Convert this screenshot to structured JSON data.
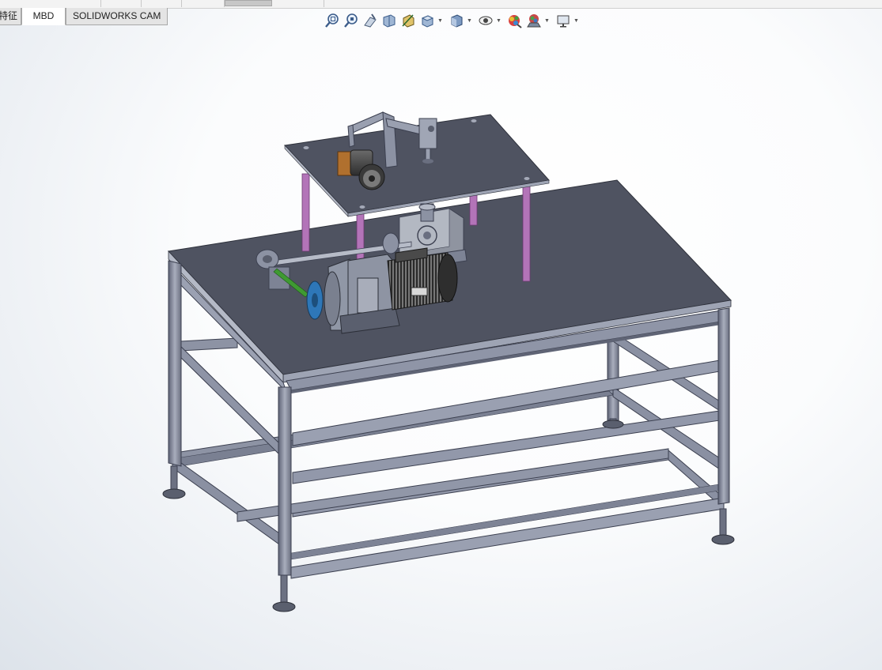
{
  "tabs": [
    {
      "label": "特征"
    },
    {
      "label": "MBD"
    },
    {
      "label": "SOLIDWORKS CAM"
    }
  ],
  "heads_up_toolbar": [
    {
      "icon": "zoom-to-fit-icon"
    },
    {
      "icon": "zoom-to-area-icon"
    },
    {
      "icon": "previous-view-icon"
    },
    {
      "icon": "section-view-icon"
    },
    {
      "icon": "dynamic-annotation-views-icon"
    },
    {
      "icon": "view-orientation-icon",
      "dropdown": true
    },
    {
      "icon": "display-style-icon",
      "dropdown": true
    },
    {
      "icon": "hide-show-items-icon",
      "dropdown": true
    },
    {
      "icon": "edit-appearance-icon"
    },
    {
      "icon": "apply-scene-icon",
      "dropdown": true
    },
    {
      "icon": "view-settings-icon",
      "dropdown": true
    }
  ],
  "colors": {
    "frame": "#8f95a7",
    "frame_dark": "#5b6072",
    "tabletop": "#4f5361",
    "tabletop_edge": "#9aa0b0",
    "standoff": "#b374b8",
    "background_top": "#ffffff",
    "background_edge": "#dde3ea"
  }
}
